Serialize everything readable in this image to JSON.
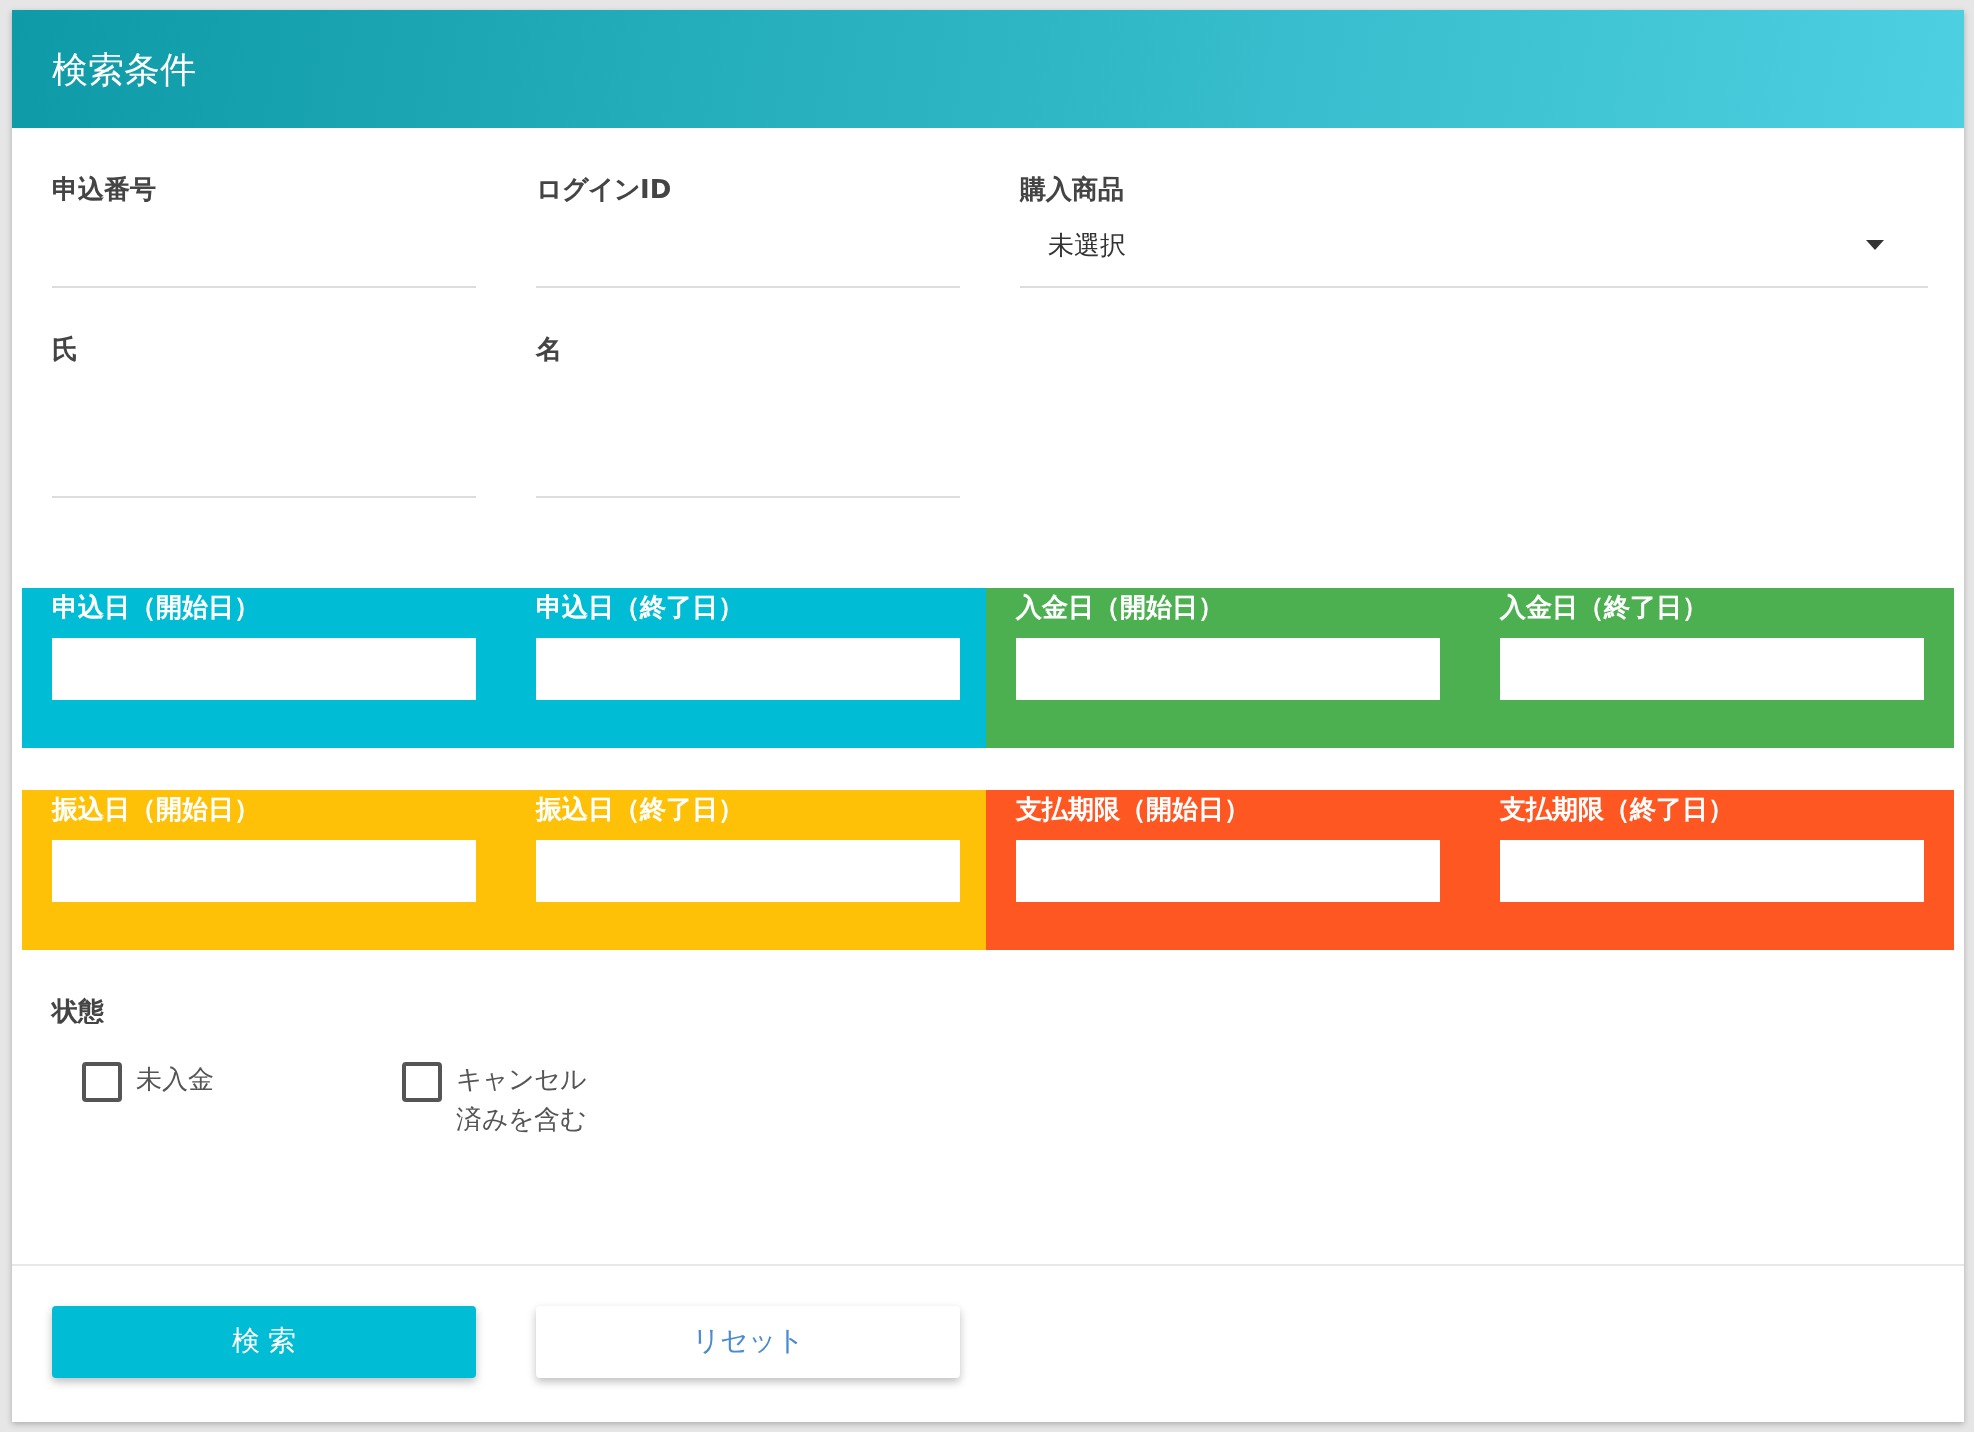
{
  "header": {
    "title": "検索条件"
  },
  "text_fields": [
    {
      "label": "申込番号"
    },
    {
      "label": "ログインID"
    }
  ],
  "product_select": {
    "label": "購入商品",
    "value": "未選択"
  },
  "name_fields": [
    {
      "label": "氏"
    },
    {
      "label": "名"
    }
  ],
  "date_groups": [
    {
      "color": "#00bcd4",
      "fields": [
        {
          "label": "申込日（開始日）"
        },
        {
          "label": "申込日（終了日）"
        }
      ]
    },
    {
      "color": "#4caf50",
      "fields": [
        {
          "label": "入金日（開始日）"
        },
        {
          "label": "入金日（終了日）"
        }
      ]
    },
    {
      "color": "#ffc107",
      "fields": [
        {
          "label": "振込日（開始日）"
        },
        {
          "label": "振込日（終了日）"
        }
      ]
    },
    {
      "color": "#ff5722",
      "fields": [
        {
          "label": "支払期限（開始日）"
        },
        {
          "label": "支払期限（終了日）"
        }
      ]
    }
  ],
  "status": {
    "label": "状態",
    "options": [
      {
        "label": "未入金",
        "checked": false
      },
      {
        "label": "キャンセル済みを含む",
        "checked": false
      }
    ]
  },
  "buttons": [
    {
      "kind": "primary",
      "label": "検 索"
    },
    {
      "kind": "secondary",
      "label": "リセット"
    }
  ]
}
